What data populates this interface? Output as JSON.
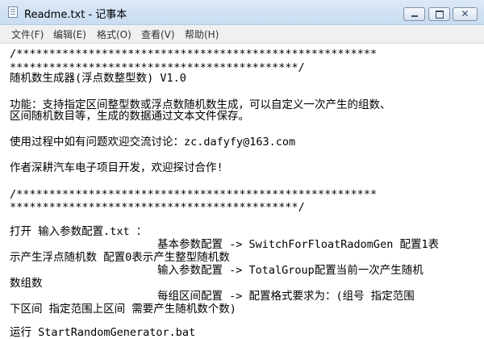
{
  "window": {
    "title": "Readme.txt - 记事本",
    "icon": "notepad-icon",
    "buttons": {
      "minimize": "minimize-icon",
      "maximize": "maximize-icon",
      "close_glyph": "✕"
    }
  },
  "menu": {
    "items": [
      "文件(F)",
      "编辑(E)",
      "格式(O)",
      "查看(V)",
      "帮助(H)"
    ]
  },
  "document": {
    "lines": [
      "/*******************************************************",
      "********************************************/",
      "随机数生成器(浮点数整型数) V1.0",
      "功能：支持指定区间整型数或浮点数随机数生成，可以自定义一次产生的组数、",
      "区间随机数目等，生成的数据通过文本文件保存。",
      "使用过程中如有问题欢迎交流讨论：zc.dafyfy@163.com",
      "作者深耕汽车电子项目开发，欢迎探讨合作!",
      "/*******************************************************",
      "********************************************/",
      "打开 输入参数配置.txt ：",
      "基本参数配置 -> SwitchForFloatRadomGen 配置1表",
      "示产生浮点随机数 配置0表示产生整型随机数",
      "输入参数配置 -> TotalGroup配置当前一次产生随机",
      "数组数",
      "每组区间配置 -> 配置格式要求为：(组号 指定范围",
      "下区间 指定范围上区间 需要产生随机数个数)",
      "运行 StartRandomGenerator.bat"
    ]
  }
}
